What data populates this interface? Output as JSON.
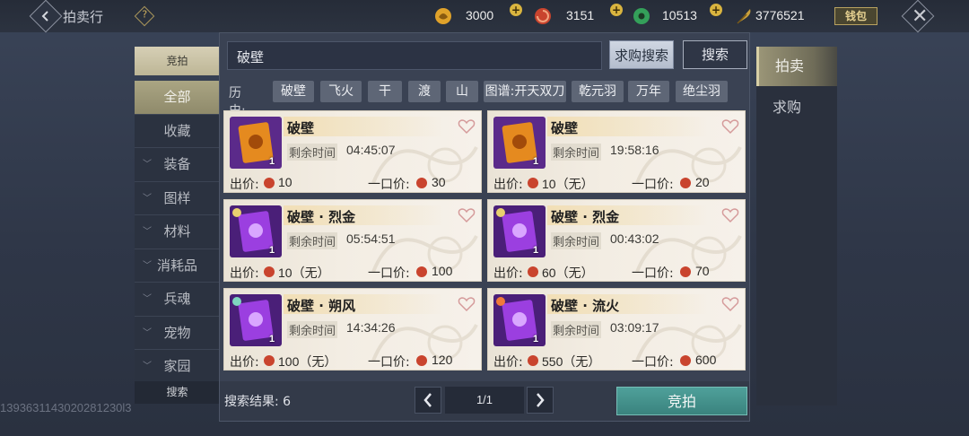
{
  "header": {
    "title": "拍卖行",
    "help_glyph": "?",
    "currencies": [
      {
        "name": "gold-ingot",
        "value": "3000",
        "color": "#e0a22a"
      },
      {
        "name": "red-orb",
        "value": "3151",
        "color": "#c9442e"
      },
      {
        "name": "jade-coin",
        "value": "10513",
        "color": "#34a05a"
      },
      {
        "name": "gold-feather",
        "value": "3776521",
        "color": "#c9a03d"
      }
    ],
    "wallet_label": "钱包",
    "close_glyph": "✕"
  },
  "sidebar": {
    "top_tab": "竞拍",
    "categories": [
      {
        "label": "全部",
        "expandable": false,
        "active": true
      },
      {
        "label": "收藏",
        "expandable": false,
        "active": false
      },
      {
        "label": "装备",
        "expandable": true,
        "active": false
      },
      {
        "label": "图样",
        "expandable": true,
        "active": false
      },
      {
        "label": "材料",
        "expandable": true,
        "active": false
      },
      {
        "label": "消耗品",
        "expandable": true,
        "active": false
      },
      {
        "label": "兵魂",
        "expandable": true,
        "active": false
      },
      {
        "label": "宠物",
        "expandable": true,
        "active": false
      },
      {
        "label": "家园",
        "expandable": true,
        "active": false
      }
    ],
    "search_label": "搜索",
    "player_id": "1393631143020281230l3"
  },
  "right_tabs": [
    {
      "label": "拍卖",
      "active": true
    },
    {
      "label": "求购",
      "active": false
    }
  ],
  "search": {
    "query": "破壁",
    "want_to_buy_label": "求购搜索",
    "search_label": "搜索"
  },
  "history": {
    "label": "历史:",
    "items": [
      "破壁",
      "飞火",
      "干",
      "渡",
      "山",
      "图谱:开天双刀",
      "乾元羽",
      "万年",
      "绝尘羽"
    ]
  },
  "listings": [
    {
      "name": "破壁",
      "time_label": "剩余时间",
      "time": "04:45:07",
      "bid_label": "出价:",
      "bid": "10",
      "buyout_label": "一口价:",
      "buyout": "30",
      "count": "1",
      "icon_style": "orange"
    },
    {
      "name": "破壁",
      "time_label": "剩余时间",
      "time": "19:58:16",
      "bid_label": "出价:",
      "bid": "10（无）",
      "buyout_label": "一口价:",
      "buyout": "20",
      "count": "1",
      "icon_style": "orange"
    },
    {
      "name": "破壁 · 烈金",
      "time_label": "剩余时间",
      "time": "05:54:51",
      "bid_label": "出价:",
      "bid": "10（无）",
      "buyout_label": "一口价:",
      "buyout": "100",
      "count": "1",
      "icon_style": "purple"
    },
    {
      "name": "破壁 · 烈金",
      "time_label": "剩余时间",
      "time": "00:43:02",
      "bid_label": "出价:",
      "bid": "60（无）",
      "buyout_label": "一口价:",
      "buyout": "70",
      "count": "1",
      "icon_style": "purple"
    },
    {
      "name": "破壁 · 朔风",
      "time_label": "剩余时间",
      "time": "14:34:26",
      "bid_label": "出价:",
      "bid": "100（无）",
      "buyout_label": "一口价:",
      "buyout": "120",
      "count": "1",
      "icon_style": "purple"
    },
    {
      "name": "破壁 · 流火",
      "time_label": "剩余时间",
      "time": "03:09:17",
      "bid_label": "出价:",
      "bid": "550（无）",
      "buyout_label": "一口价:",
      "buyout": "600",
      "count": "1",
      "icon_style": "purple"
    }
  ],
  "footer": {
    "result_label": "搜索结果:",
    "result_count": "6",
    "page": "1/1",
    "bid_button": "竞拍"
  }
}
